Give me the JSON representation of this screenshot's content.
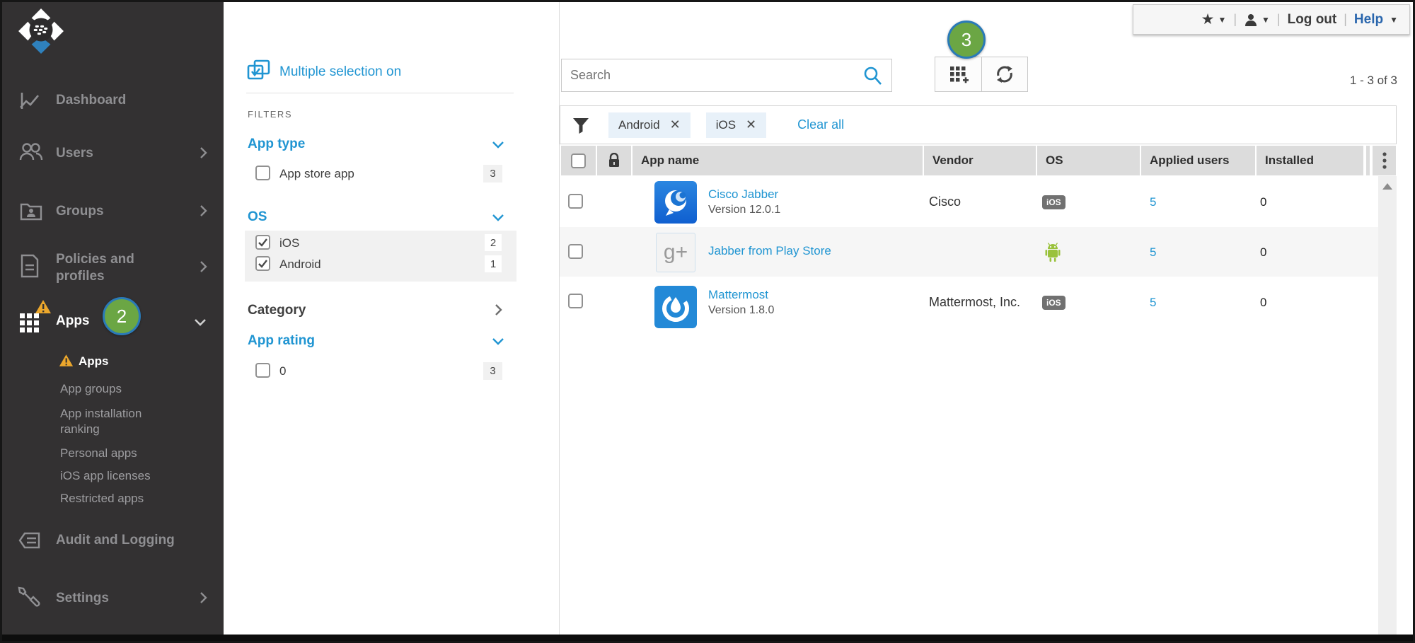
{
  "colors": {
    "accent_blue": "#2095d2",
    "sidebar_bg": "#333132",
    "green_badge": "#6ba644",
    "badge_border": "#2a7ab8",
    "warning_amber": "#eca72c",
    "android_green": "#9ac23c",
    "ios_badge_bg": "#717171"
  },
  "topbar": {
    "logout": "Log out",
    "help": "Help"
  },
  "sidebar": {
    "dashboard": "Dashboard",
    "users": "Users",
    "groups": "Groups",
    "policies": "Policies and profiles",
    "apps": "Apps",
    "apps_badge": "2",
    "sub": {
      "apps": "Apps",
      "app_groups": "App groups",
      "app_installation_ranking": "App installation ranking",
      "personal_apps": "Personal apps",
      "ios_app_licenses": "iOS app licenses",
      "restricted_apps": "Restricted apps"
    },
    "audit": "Audit and Logging",
    "settings": "Settings"
  },
  "filters": {
    "multiple_selection": "Multiple selection on",
    "heading": "FILTERS",
    "app_type": {
      "title": "App type",
      "option": "App store app",
      "count": "3"
    },
    "os": {
      "title": "OS",
      "ios": "iOS",
      "ios_count": "2",
      "android": "Android",
      "android_count": "1"
    },
    "category": {
      "title": "Category"
    },
    "app_rating": {
      "title": "App rating",
      "option": "0",
      "count": "3"
    }
  },
  "toolbar": {
    "search_placeholder": "Search",
    "add_badge": "3",
    "range": "1 - 3 of 3"
  },
  "filterbar": {
    "chips": [
      "Android",
      "iOS"
    ],
    "clear_all": "Clear all"
  },
  "table": {
    "headers": {
      "app_name": "App name",
      "vendor": "Vendor",
      "os": "OS",
      "applied_users": "Applied users",
      "installed": "Installed"
    },
    "rows": [
      {
        "name": "Cisco Jabber",
        "version": "Version 12.0.1",
        "vendor": "Cisco",
        "os": "iOS",
        "applied": "5",
        "installed": "0"
      },
      {
        "name": "Jabber from Play Store",
        "version": "",
        "vendor": "",
        "os": "Android",
        "applied": "5",
        "installed": "0"
      },
      {
        "name": "Mattermost",
        "version": "Version 1.8.0",
        "vendor": "Mattermost, Inc.",
        "os": "iOS",
        "applied": "5",
        "installed": "0"
      }
    ]
  }
}
